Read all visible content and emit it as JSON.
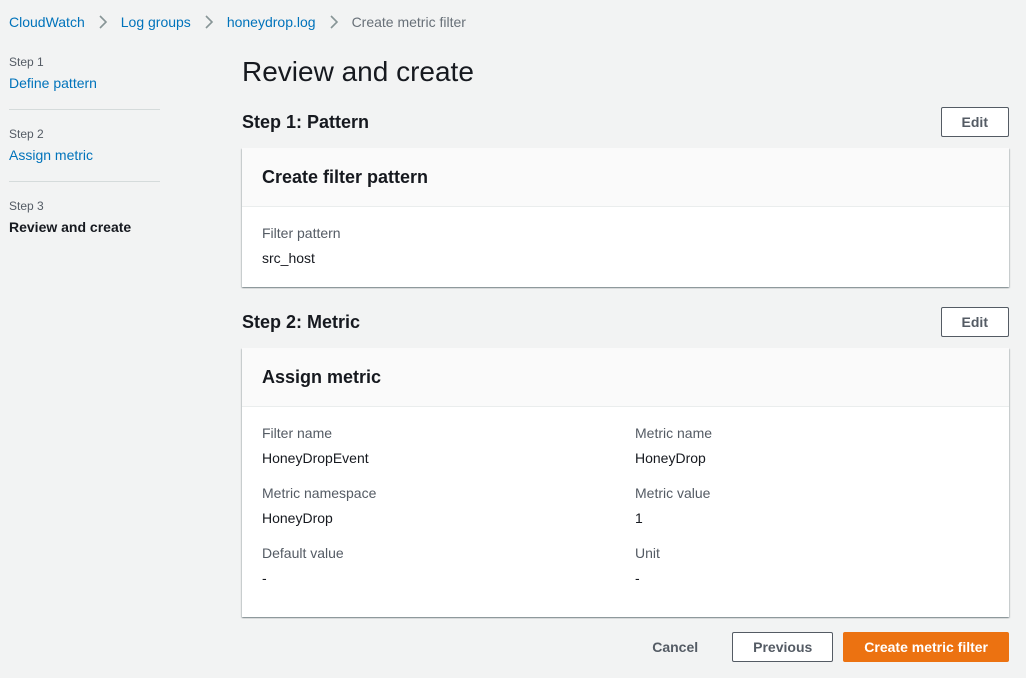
{
  "breadcrumb": {
    "items": [
      "CloudWatch",
      "Log groups",
      "honeydrop.log"
    ],
    "current": "Create metric filter"
  },
  "steps": [
    {
      "num": "Step 1",
      "label": "Define pattern"
    },
    {
      "num": "Step 2",
      "label": "Assign metric"
    },
    {
      "num": "Step 3",
      "label": "Review and create"
    }
  ],
  "page_title": "Review and create",
  "section1": {
    "title": "Step 1: Pattern",
    "edit_label": "Edit",
    "card_title": "Create filter pattern",
    "filter_pattern_label": "Filter pattern",
    "filter_pattern_value": "src_host"
  },
  "section2": {
    "title": "Step 2: Metric",
    "edit_label": "Edit",
    "card_title": "Assign metric",
    "filter_name_label": "Filter name",
    "filter_name_value": "HoneyDropEvent",
    "metric_name_label": "Metric name",
    "metric_name_value": "HoneyDrop",
    "metric_namespace_label": "Metric namespace",
    "metric_namespace_value": "HoneyDrop",
    "metric_value_label": "Metric value",
    "metric_value_value": "1",
    "default_value_label": "Default value",
    "default_value_value": "-",
    "unit_label": "Unit",
    "unit_value": "-"
  },
  "footer": {
    "cancel_label": "Cancel",
    "previous_label": "Previous",
    "create_label": "Create metric filter"
  },
  "colors": {
    "link": "#0073bb",
    "primary": "#ec7211",
    "background": "#f2f3f3"
  },
  "icons": {
    "breadcrumb_separator": "chevron-right-icon"
  }
}
